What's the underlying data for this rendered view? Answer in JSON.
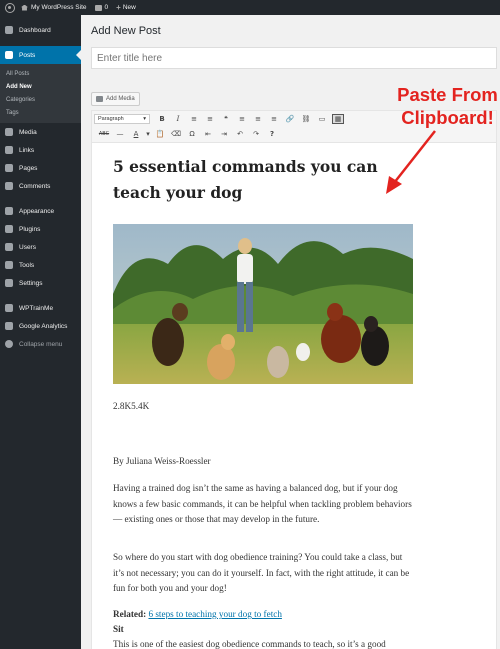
{
  "adminbar": {
    "site_name": "My WordPress Site",
    "comments_count": "0",
    "new_label": "New"
  },
  "sidebar": {
    "items": [
      {
        "label": "Dashboard",
        "icon": "dashboard-icon"
      },
      {
        "label": "Posts",
        "icon": "pushpin-icon",
        "active": true
      },
      {
        "label": "Media",
        "icon": "media-icon"
      },
      {
        "label": "Links",
        "icon": "link-icon"
      },
      {
        "label": "Pages",
        "icon": "pages-icon"
      },
      {
        "label": "Comments",
        "icon": "comments-icon"
      },
      {
        "label": "Appearance",
        "icon": "brush-icon"
      },
      {
        "label": "Plugins",
        "icon": "plugin-icon"
      },
      {
        "label": "Users",
        "icon": "users-icon"
      },
      {
        "label": "Tools",
        "icon": "wrench-icon"
      },
      {
        "label": "Settings",
        "icon": "settings-icon"
      },
      {
        "label": "WPTrainMe",
        "icon": "gear-icon"
      },
      {
        "label": "Google Analytics",
        "icon": "analytics-icon"
      },
      {
        "label": "Collapse menu",
        "icon": "collapse-icon"
      }
    ],
    "posts_submenu": [
      "All Posts",
      "Add New",
      "Categories",
      "Tags"
    ]
  },
  "page": {
    "title": "Add New Post",
    "title_placeholder": "Enter title here",
    "add_media_label": "Add Media",
    "format_select": "Paragraph"
  },
  "toolbar": {
    "row1": [
      "B",
      "I",
      "≡",
      "≡",
      "❝",
      "≡",
      "≡",
      "≡",
      "🔗",
      "⛓",
      "▭",
      "▦"
    ],
    "row2": [
      "ABC",
      "—",
      "A",
      "▾",
      "📋",
      "⌫",
      "Ω",
      "⇤",
      "⇥",
      "↶",
      "↷",
      "?"
    ]
  },
  "post": {
    "title": "5 essential commands you can teach your dog",
    "share_counts": "2.8K5.4K",
    "byline": "By Juliana Weiss-Roessler",
    "para1": "Having a trained dog isn’t the same as having a balanced dog, but if your dog knows a few basic commands, it can be helpful when tackling problem behaviors — existing ones or those that may develop in the future.",
    "para2": "So where do you start with dog obedience training? You could take a class, but it’s not necessary; you can do it yourself. In fact, with the right attitude, it can be fun for both you and your dog!",
    "related_label": "Related:",
    "related_link": "6 steps to teaching your dog to fetch",
    "sit_heading": "Sit",
    "sit_text": "This is one of the easiest dog obedience commands to teach, so it’s a good"
  },
  "annotation": {
    "callout_line1": "Paste From",
    "callout_line2": "Clipboard!"
  },
  "colors": {
    "sidebar_bg": "#23282d",
    "active_menu": "#0073aa",
    "callout_red": "#e3231f",
    "link": "#0073aa"
  }
}
